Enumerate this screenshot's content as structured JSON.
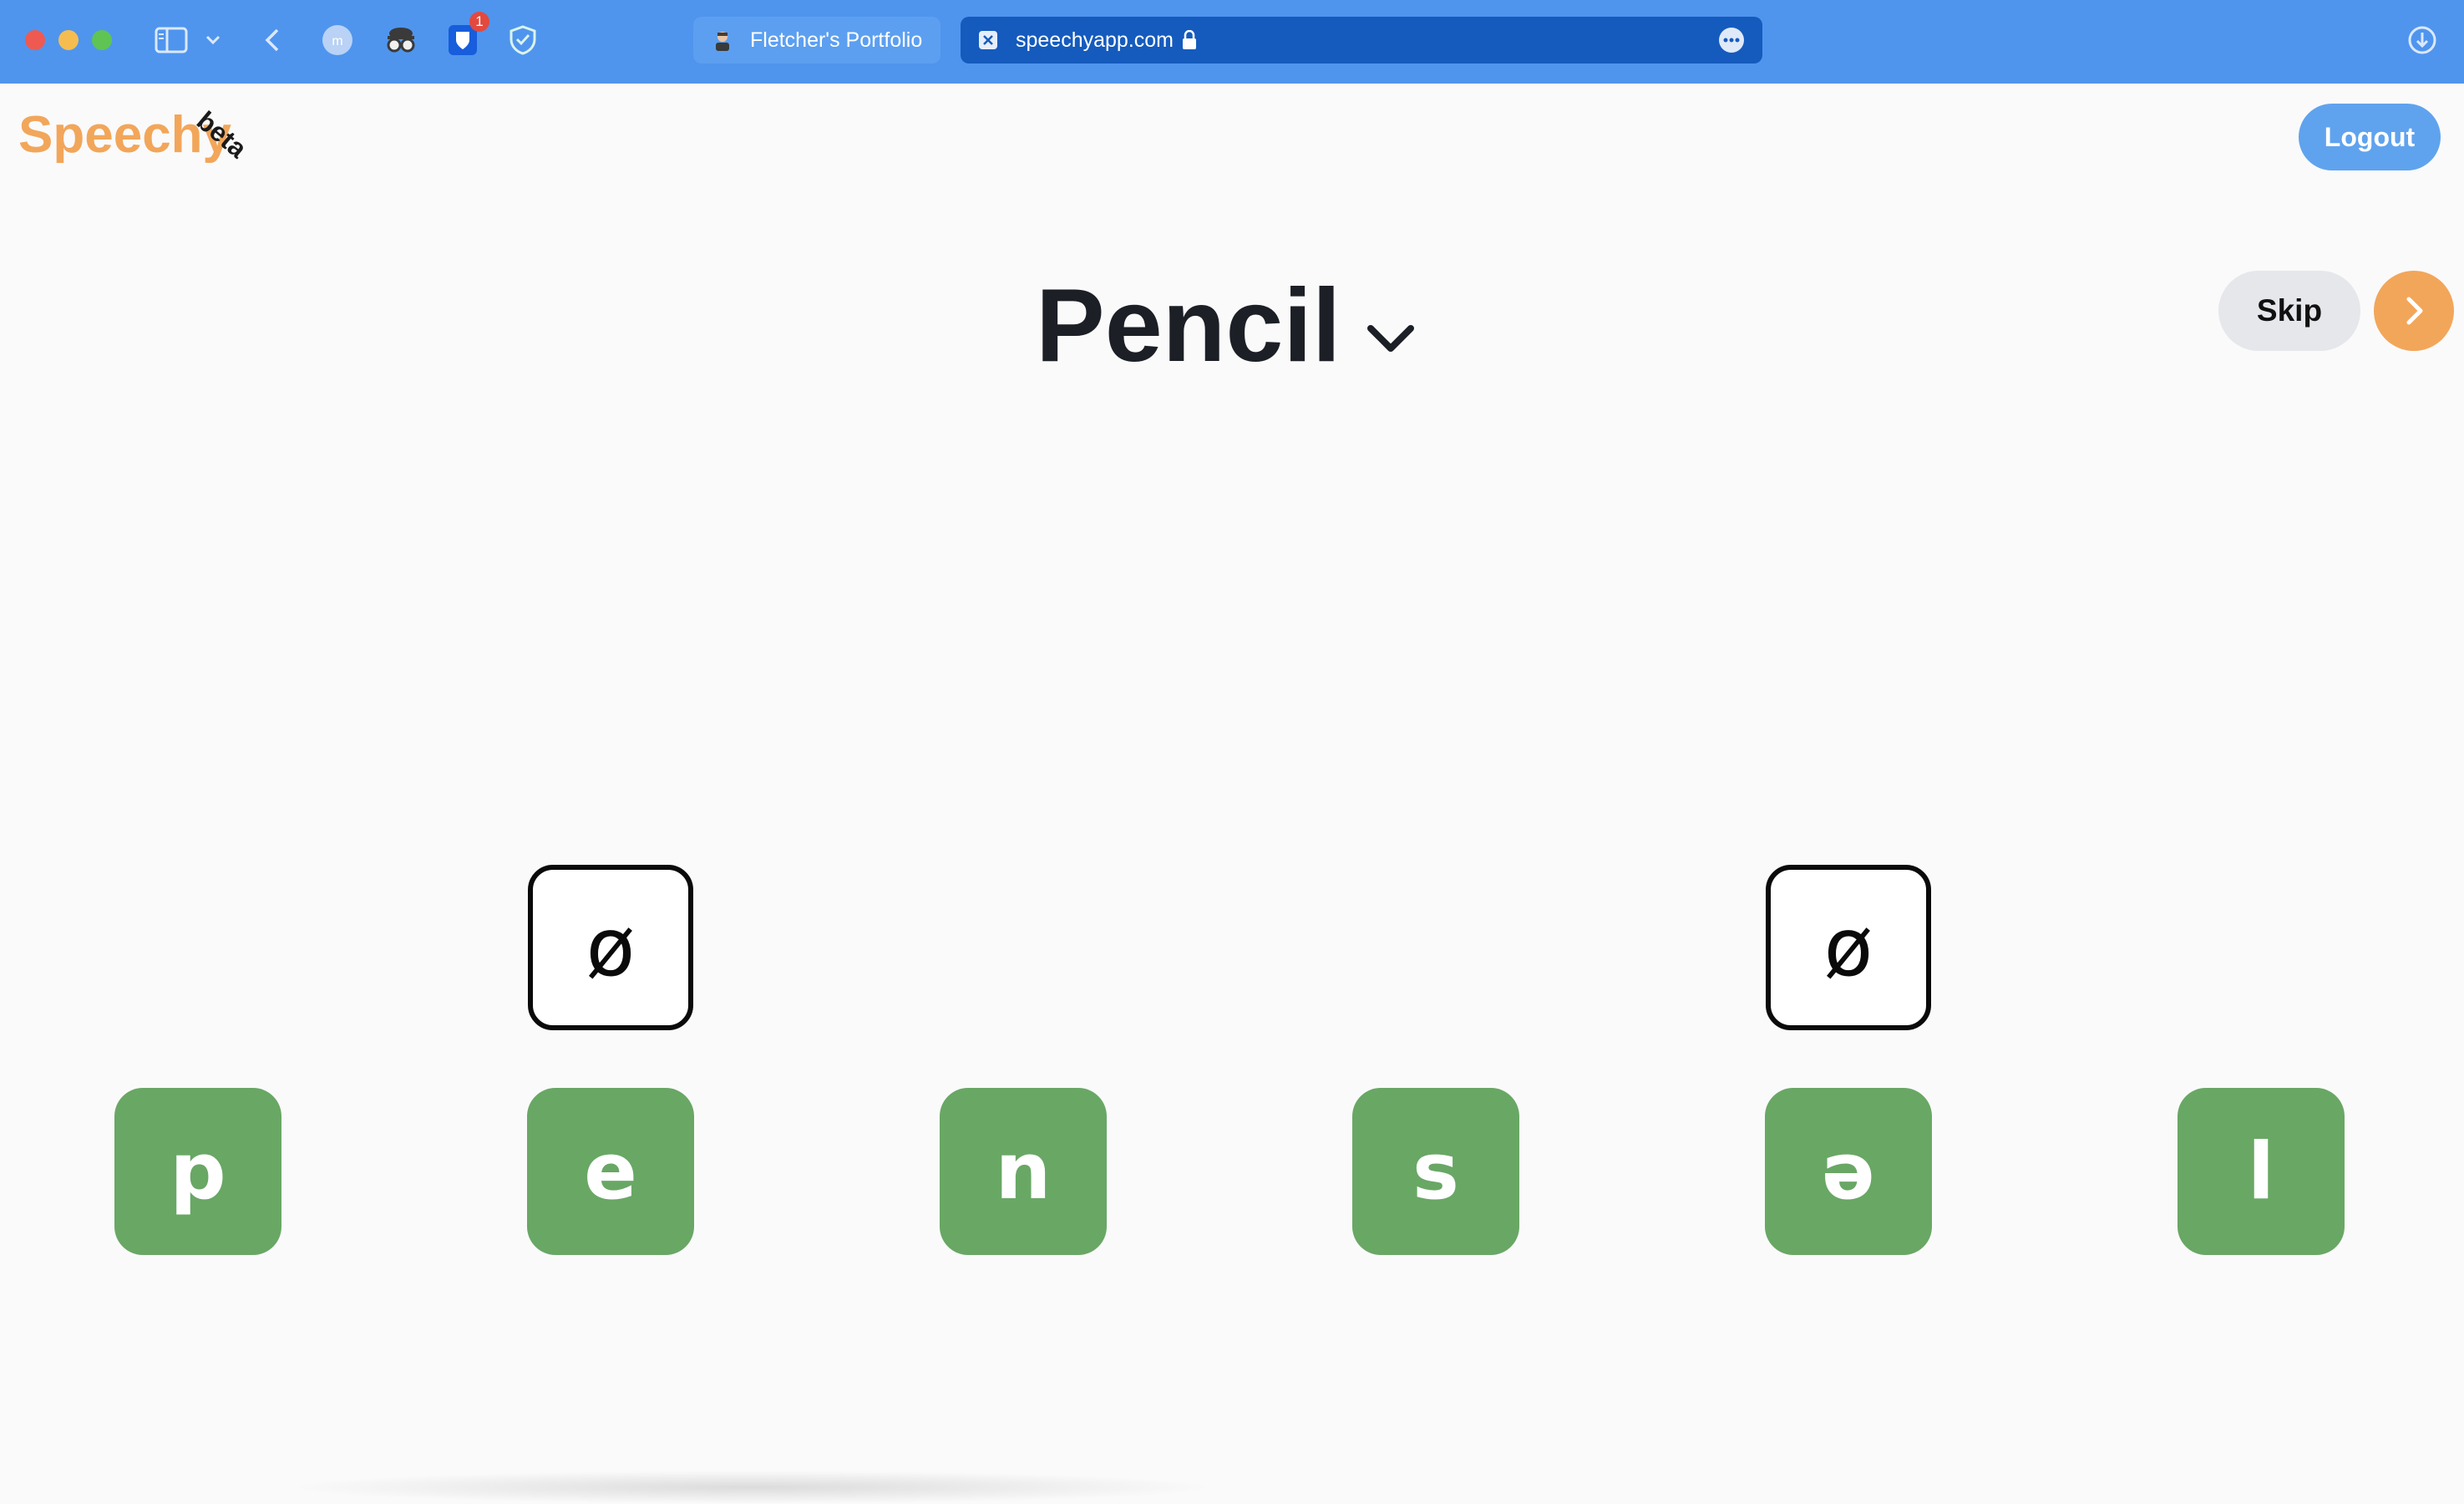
{
  "browser": {
    "tabs": [
      {
        "label": "Fletcher's Portfolio",
        "active": false
      },
      {
        "label": "speechyapp.com",
        "active": true
      }
    ],
    "extension_badge": "1",
    "colors": {
      "toolbar": "#4f95ee",
      "active_tab": "#155bbd"
    }
  },
  "app": {
    "logo": "Speechy",
    "logo_tag": "beta",
    "logout_label": "Logout",
    "word": "Pencil",
    "skip_label": "Skip",
    "slots": [
      {
        "symbol": "ø",
        "column": 2
      },
      {
        "symbol": "ø",
        "column": 5
      }
    ],
    "tiles": [
      "p",
      "e",
      "n",
      "s",
      "ə",
      "l"
    ],
    "colors": {
      "logo": "#f2a65a",
      "tile": "#69a765",
      "logout": "#5fa3ee",
      "next": "#f2a65a"
    },
    "icons": [
      "chevron-down-icon",
      "chevron-right-icon"
    ]
  }
}
